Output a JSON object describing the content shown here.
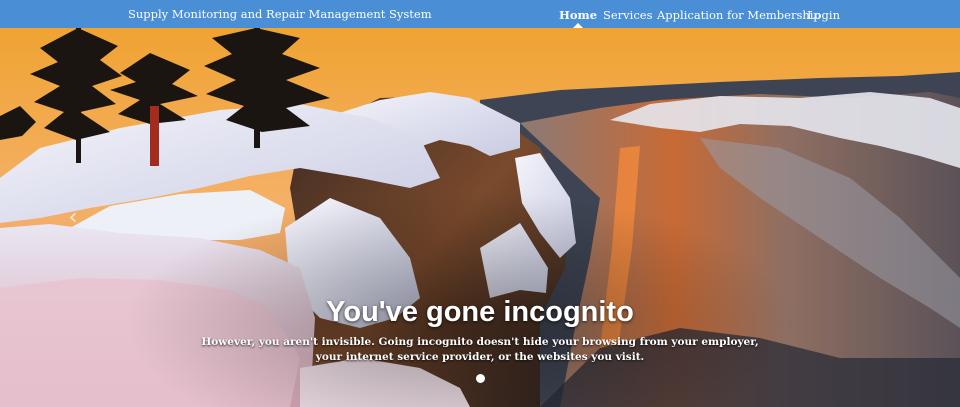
{
  "navbar": {
    "brand": "Supply Monitoring and Repair Management System",
    "color": "#4a8fd6",
    "items": [
      {
        "label": "Home",
        "active": true
      },
      {
        "label": "Services",
        "active": false
      },
      {
        "label": "Application for Membership",
        "active": false
      },
      {
        "label": "Login",
        "active": false
      }
    ]
  },
  "carousel": {
    "prev_icon": "chevron-left-icon",
    "slide": {
      "title": "You've gone incognito",
      "text": "However, you aren't invisible. Going incognito doesn't hide your browsing from your employer, your internet service provider, or the websites you visit."
    },
    "indicator_count": 1,
    "active_indicator": 0
  }
}
